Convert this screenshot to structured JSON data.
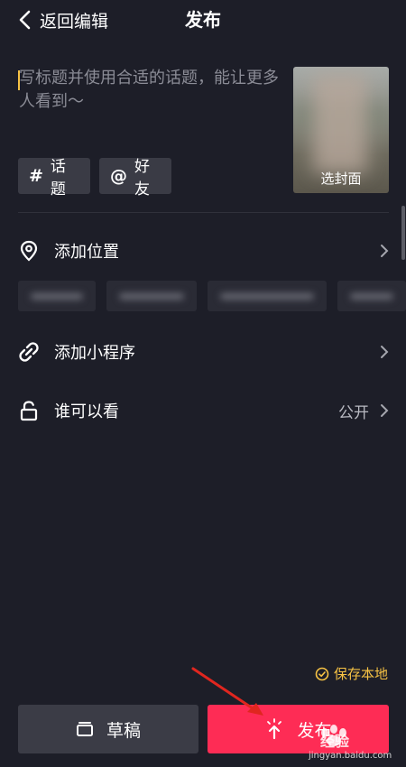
{
  "header": {
    "back_label": "返回编辑",
    "title": "发布"
  },
  "caption": {
    "placeholder": "写标题并使用合适的话题，能让更多人看到～",
    "value": ""
  },
  "cover": {
    "label": "选封面"
  },
  "chips": {
    "topic": {
      "symbol": "#",
      "label": "话题"
    },
    "friend": {
      "symbol": "@",
      "label": "好友"
    }
  },
  "rows": {
    "location": {
      "label": "添加位置",
      "icon": "location-pin-icon"
    },
    "mini_program": {
      "label": "添加小程序",
      "icon": "link-icon"
    },
    "visibility": {
      "label": "谁可以看",
      "value": "公开",
      "icon": "unlock-icon"
    }
  },
  "save_local": {
    "label": "保存本地",
    "checked": true,
    "color": "#f6c244"
  },
  "buttons": {
    "draft": "草稿",
    "publish": "发布"
  },
  "watermark": {
    "text": "经验",
    "url": "jingyan.baidu.com"
  },
  "colors": {
    "background": "#1d1e28",
    "accent": "#fe2c55",
    "chip_bg": "#3a3b45",
    "highlight": "#f6c244"
  }
}
